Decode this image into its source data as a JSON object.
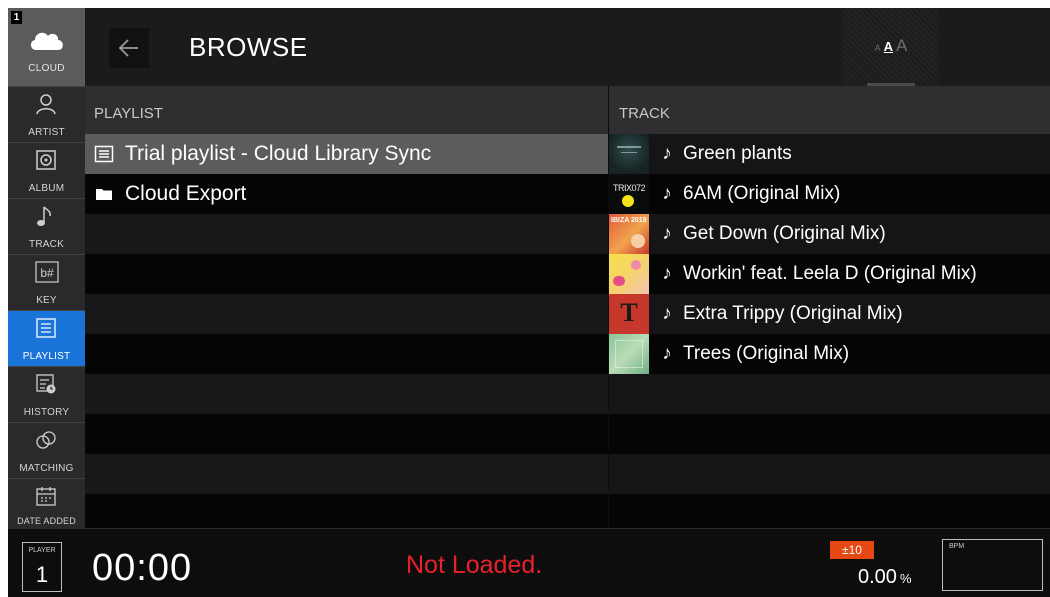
{
  "rail": {
    "deck_number": "1",
    "cloud_label": "CLOUD",
    "categories": [
      {
        "label": "ARTIST",
        "icon": "artist-icon"
      },
      {
        "label": "ALBUM",
        "icon": "album-icon"
      },
      {
        "label": "TRACK",
        "icon": "track-icon"
      },
      {
        "label": "KEY",
        "icon": "key-icon"
      },
      {
        "label": "PLAYLIST",
        "icon": "playlist-icon",
        "active": true
      },
      {
        "label": "HISTORY",
        "icon": "history-icon"
      },
      {
        "label": "MATCHING",
        "icon": "matching-icon"
      },
      {
        "label": "DATE ADDED",
        "icon": "date-added-icon"
      }
    ],
    "key_icon_text": "b#"
  },
  "header": {
    "title": "BROWSE",
    "font_size_letters": [
      "A",
      "A",
      "A"
    ]
  },
  "playlist": {
    "header": "PLAYLIST",
    "items": [
      {
        "label": "Trial playlist - Cloud Library Sync",
        "icon": "playlist-list-icon",
        "selected": true
      },
      {
        "label": "Cloud Export",
        "icon": "folder-icon",
        "selected": false
      }
    ]
  },
  "track": {
    "header": "TRACK",
    "items": [
      {
        "title": "Green plants",
        "note_icon": "♪"
      },
      {
        "title": "6AM (Original Mix)",
        "note_icon": "♪",
        "art_text": "TRIX072"
      },
      {
        "title": "Get Down (Original Mix)",
        "note_icon": "♪",
        "art_text": "IBIZA 2019"
      },
      {
        "title": "Workin' feat. Leela D (Original Mix)",
        "note_icon": "♪"
      },
      {
        "title": "Extra Trippy (Original Mix)",
        "note_icon": "♪",
        "art_text": "T"
      },
      {
        "title": "Trees (Original Mix)",
        "note_icon": "♪"
      }
    ]
  },
  "bottom": {
    "player_label": "PLAYER",
    "player_number": "1",
    "time": "00:00",
    "status": "Not Loaded.",
    "tempo_range": "±10",
    "pitch_value": "0.00",
    "pitch_unit": "%",
    "bpm_label": "BPM"
  },
  "colors": {
    "accent": "#1a73d9",
    "status_red": "#e8212b",
    "tempo_orange": "#e54813",
    "selected_row": "#5c5c5f"
  }
}
